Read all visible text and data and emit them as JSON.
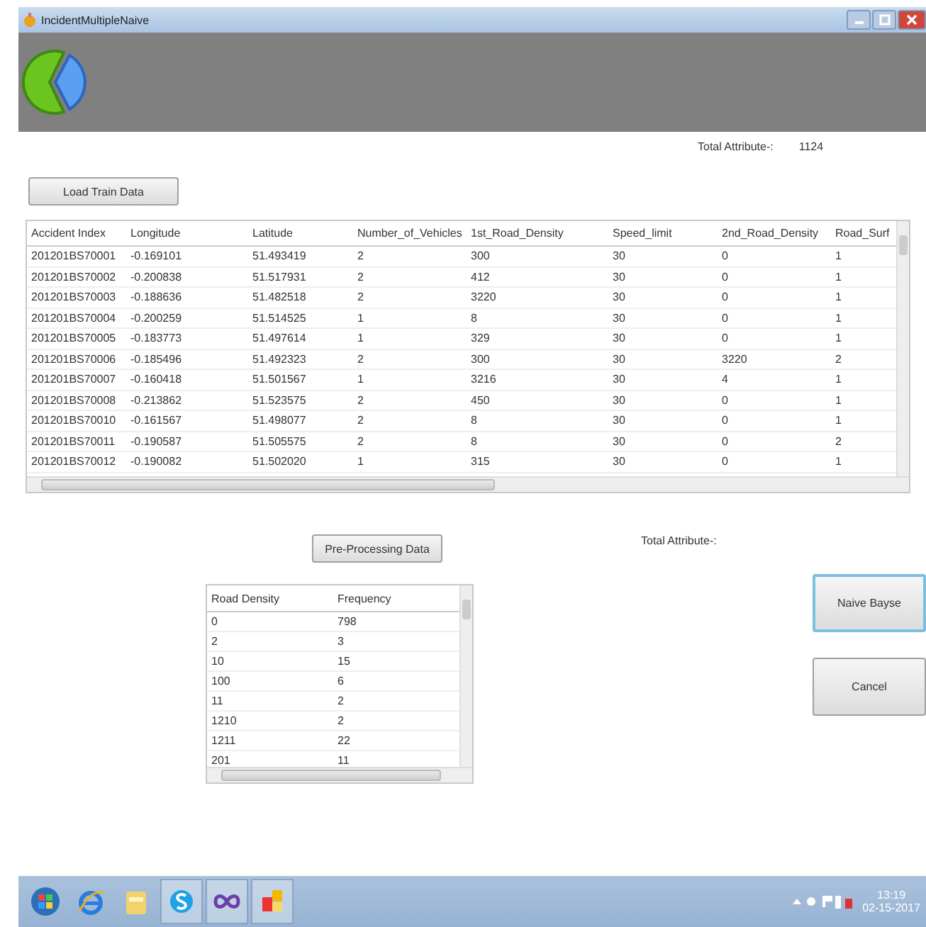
{
  "window": {
    "title": "IncidentMultipleNaive"
  },
  "top_total": {
    "label": "Total Attribute-:",
    "value": "1124"
  },
  "load_button": "Load Train Data",
  "train_table": {
    "columns": [
      "Accident Index",
      "Longitude",
      "Latitude",
      "Number_of_Vehicles",
      "1st_Road_Density",
      "Speed_limit",
      "2nd_Road_Density",
      "Road_Surf"
    ],
    "rows": [
      [
        "201201BS70001",
        "-0.169101",
        "51.493419",
        "2",
        "300",
        "30",
        "0",
        "1"
      ],
      [
        "201201BS70002",
        "-0.200838",
        "51.517931",
        "2",
        "412",
        "30",
        "0",
        "1"
      ],
      [
        "201201BS70003",
        "-0.188636",
        "51.482518",
        "2",
        "3220",
        "30",
        "0",
        "1"
      ],
      [
        "201201BS70004",
        "-0.200259",
        "51.514525",
        "1",
        "8",
        "30",
        "0",
        "1"
      ],
      [
        "201201BS70005",
        "-0.183773",
        "51.497614",
        "1",
        "329",
        "30",
        "0",
        "1"
      ],
      [
        "201201BS70006",
        "-0.185496",
        "51.492323",
        "2",
        "300",
        "30",
        "3220",
        "2"
      ],
      [
        "201201BS70007",
        "-0.160418",
        "51.501567",
        "1",
        "3216",
        "30",
        "4",
        "1"
      ],
      [
        "201201BS70008",
        "-0.213862",
        "51.523575",
        "2",
        "450",
        "30",
        "0",
        "1"
      ],
      [
        "201201BS70010",
        "-0.161567",
        "51.498077",
        "2",
        "8",
        "30",
        "0",
        "1"
      ],
      [
        "201201BS70011",
        "-0.190587",
        "51.505575",
        "2",
        "8",
        "30",
        "0",
        "2"
      ],
      [
        "201201BS70012",
        "-0.190082",
        "51.502020",
        "1",
        "315",
        "30",
        "0",
        "1"
      ]
    ]
  },
  "preprocess_button": "Pre-Processing Data",
  "bottom_total": {
    "label": "Total Attribute-:"
  },
  "density_table": {
    "columns": [
      "Road Density",
      "Frequency"
    ],
    "rows": [
      [
        "0",
        "798"
      ],
      [
        "2",
        "3"
      ],
      [
        "10",
        "15"
      ],
      [
        "100",
        "6"
      ],
      [
        "11",
        "2"
      ],
      [
        "1210",
        "2"
      ],
      [
        "1211",
        "22"
      ],
      [
        "201",
        "11"
      ]
    ]
  },
  "buttons": [
    {
      "label": "Naive Bayse",
      "focused": true
    },
    {
      "label": "Cancel",
      "focused": false
    }
  ],
  "taskbar": {
    "time": "13:19",
    "date": "02-15-2017"
  }
}
